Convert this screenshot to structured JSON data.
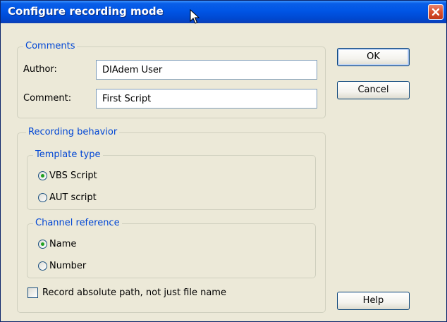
{
  "window": {
    "title": "Configure recording mode"
  },
  "comments": {
    "legend": "Comments",
    "author_label": "Author:",
    "author_value": "DIAdem User",
    "comment_label": "Comment:",
    "comment_value": "First Script"
  },
  "recording": {
    "legend": "Recording behavior",
    "template_type": {
      "legend": "Template type",
      "options": [
        "VBS Script",
        "AUT script"
      ],
      "selected": "VBS Script"
    },
    "channel_reference": {
      "legend": "Channel reference",
      "options": [
        "Name",
        "Number"
      ],
      "selected": "Name"
    },
    "absolute_path_label": "Record absolute path, not just file name",
    "absolute_path_checked": false
  },
  "buttons": {
    "ok": "OK",
    "cancel": "Cancel",
    "help": "Help"
  },
  "colors": {
    "title_bar": "#0055E5",
    "dialog_bg": "#ECE9D8",
    "group_label": "#0046D5",
    "close_button": "#D8502E",
    "radio_dot": "#21A121"
  },
  "icons": {
    "close": "close-icon",
    "cursor": "mouse-pointer-icon"
  }
}
